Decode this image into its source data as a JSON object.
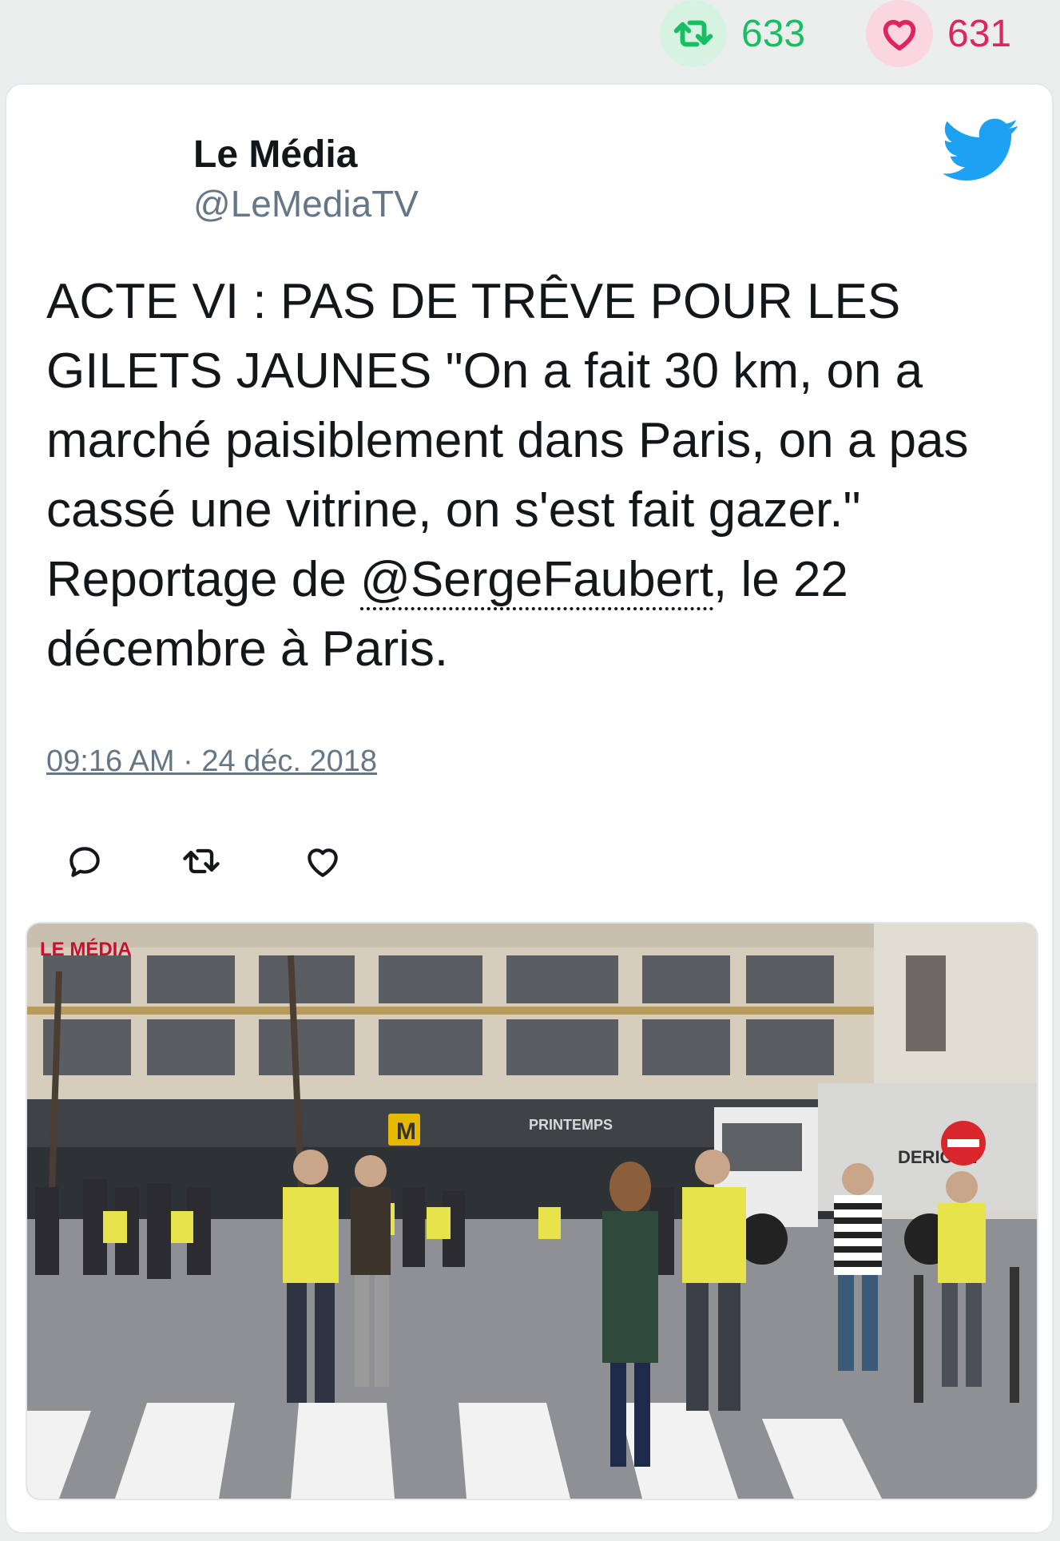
{
  "top_stats": {
    "retweet_count": "633",
    "like_count": "631"
  },
  "tweet": {
    "author_name": "Le Média",
    "author_handle": "@LeMediaTV",
    "text_before_mention": "ACTE VI : PAS DE TRÊVE POUR LES GILETS JAUNES \"On a fait 30 km, on a marché paisiblement dans Paris, on a pas cassé une vitrine, on s'est fait gazer.\" Reportage de ",
    "mention": "@SergeFaubert",
    "text_after_mention": ", le 22 décembre à Paris.",
    "timestamp": "09:16 AM · 24 déc. 2018"
  },
  "media": {
    "watermark": "LE MÉDIA",
    "metro_sign": "M",
    "store_sign": "PRINTEMPS",
    "truck_brand": "DERICHE"
  },
  "icons": {
    "retweet": "retweet-icon",
    "like": "heart-icon",
    "reply": "reply-icon",
    "brand": "twitter-bird-icon"
  },
  "colors": {
    "retweet_green": "#17bf63",
    "like_red": "#e0245e",
    "twitter_blue": "#1da1f2",
    "text": "#14171a",
    "muted": "#657786"
  }
}
